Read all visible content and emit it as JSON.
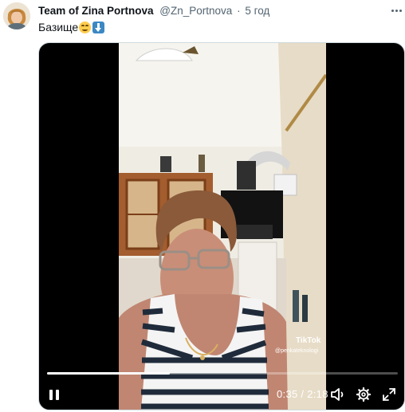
{
  "tweet": {
    "author_name": "Team of Zina Portnova",
    "handle": "@Zn_Portnova",
    "separator": "·",
    "time": "5 год",
    "text": "Базище",
    "emojis": [
      "smiling-face-emoji",
      "down-arrow-emoji"
    ]
  },
  "video": {
    "progress": 0.35,
    "timecode": "0:35 / 2:18",
    "watermark_brand": "TikTok",
    "watermark_user": "@penkateknologi"
  },
  "colors": {
    "text_primary": "#0f1419",
    "text_secondary": "#536471",
    "player_background": "#000000",
    "border": "#cfd9de"
  },
  "icons": {
    "more": "more-horizontal-icon",
    "pause": "pause-icon",
    "volume": "volume-icon",
    "settings": "gear-icon",
    "fullscreen": "expand-icon"
  }
}
